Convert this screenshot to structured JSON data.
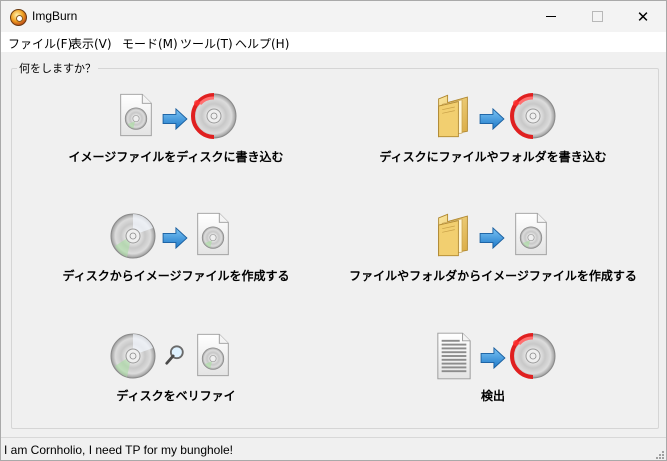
{
  "window": {
    "title": "ImgBurn"
  },
  "titlebar": {
    "minimize_symbol": "",
    "close_symbol": "✕"
  },
  "menu": [
    {
      "label": "ファイル(F)"
    },
    {
      "label": "表示(V)"
    },
    {
      "label": "モード(M)"
    },
    {
      "label": "ツール(T)"
    },
    {
      "label": "ヘルプ(H)"
    }
  ],
  "group": {
    "legend": "何をしますか？"
  },
  "tasks": [
    {
      "label": "イメージファイルをディスクに書き込む",
      "icons": [
        "image-file-icon",
        "arrow-right-icon",
        "burn-disc-icon"
      ]
    },
    {
      "label": "ディスクにファイルやフォルダを書き込む",
      "icons": [
        "folder-icon",
        "arrow-right-icon",
        "burn-disc-icon"
      ]
    },
    {
      "label": "ディスクからイメージファイルを作成する",
      "icons": [
        "disc-icon",
        "arrow-right-icon",
        "image-file-icon"
      ]
    },
    {
      "label": "ファイルやフォルダからイメージファイルを作成する",
      "icons": [
        "folder-icon",
        "arrow-right-icon",
        "image-file-icon"
      ]
    },
    {
      "label": "ディスクをベリファイ",
      "icons": [
        "disc-icon",
        "magnifier-icon",
        "image-file-icon"
      ]
    },
    {
      "label": "検出",
      "icons": [
        "binary-file-icon",
        "arrow-right-icon",
        "burn-disc-icon"
      ]
    }
  ],
  "status": {
    "text": "I am Cornholio, I need TP for my bunghole!"
  },
  "colors": {
    "accent_arrow": "#2f8fd8",
    "burn_red": "#e02020",
    "folder": "#e8c060"
  }
}
